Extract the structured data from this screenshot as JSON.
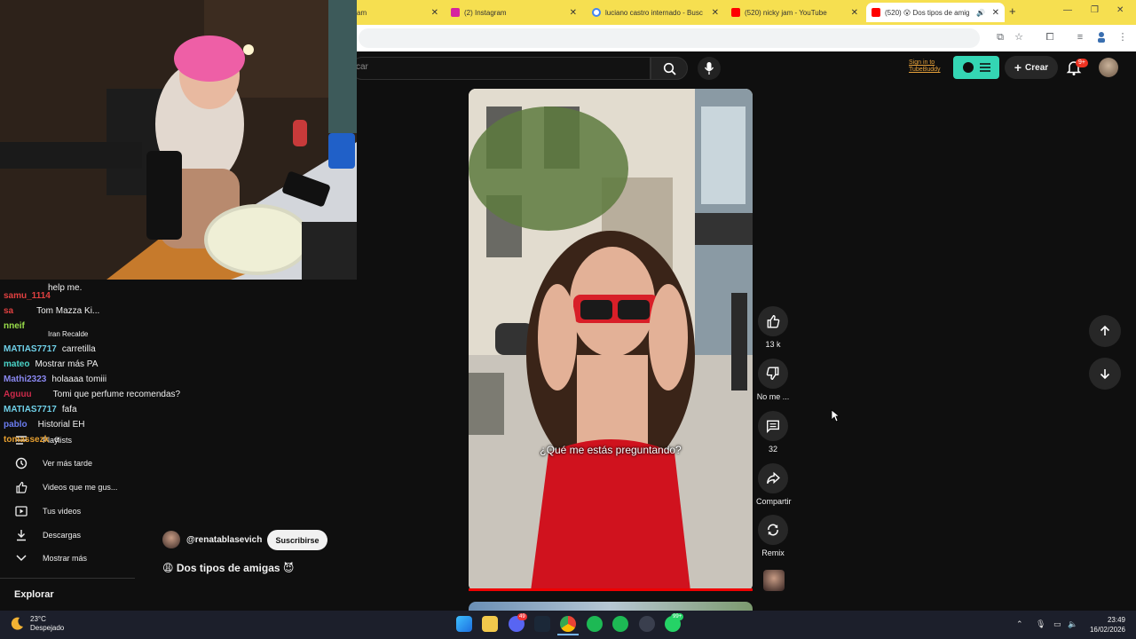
{
  "browser": {
    "tabs": [
      {
        "title": "am",
        "active": false,
        "favicon_color": "#f0c030"
      },
      {
        "title": "(2) Instagram",
        "active": false,
        "favicon_color": "#d6249f"
      },
      {
        "title": "luciano castro internado - Busc",
        "active": false,
        "favicon_color": "#4285f4"
      },
      {
        "title": "(520) nicky jam - YouTube",
        "active": false,
        "favicon_color": "#ff0000"
      },
      {
        "title": "(520) 😮 Dos tipos de amig",
        "active": true,
        "favicon_color": "#ff0000"
      }
    ],
    "new_tab_label": "+"
  },
  "youtube": {
    "search_placeholder": "car",
    "tubebuddy_line1": "Sign in to",
    "tubebuddy_line2": "TubeBuddy",
    "create_label": "Crear",
    "notifications_badge": "9+"
  },
  "chat": [
    {
      "user": "",
      "message": "help me.",
      "color": "#e04040"
    },
    {
      "user": "samu_1114",
      "message": "",
      "color": "#e04040"
    },
    {
      "user": "sa",
      "message": "Tom Mazza Ki...",
      "color": "#e04040"
    },
    {
      "user": "nneif",
      "message": "",
      "color": "#9ade4a"
    },
    {
      "user": "",
      "message": "Iran Recalde",
      "color": "#ddd"
    },
    {
      "user": "MATIAS7717",
      "message": "carretilla",
      "color": "#6fd0e8"
    },
    {
      "user": "mateo",
      "message": "Mostrar más PA",
      "color": "#4ad4c8"
    },
    {
      "user": "Mathi2323",
      "message": "holaaaa tomiii",
      "color": "#8a88f0"
    },
    {
      "user": "Aguuu",
      "message": "Tomi que perfume recomendas?",
      "color": "#cc2a4a"
    },
    {
      "user": "MATIAS7717",
      "message": "fafa",
      "color": "#6fd0e8"
    },
    {
      "user": "pablo",
      "message": "Historial EH",
      "color": "#6a7cf0"
    },
    {
      "user": "tomassezk",
      "message": "e",
      "color": "#e8a030"
    }
  ],
  "sidebar": {
    "items": [
      {
        "label": "Playlists",
        "icon": "playlist-icon"
      },
      {
        "label": "Ver más tarde",
        "icon": "clock-icon"
      },
      {
        "label": "Videos que me gus...",
        "icon": "thumbs-up-icon"
      },
      {
        "label": "Tus videos",
        "icon": "video-icon"
      },
      {
        "label": "Descargas",
        "icon": "download-icon"
      },
      {
        "label": "Mostrar más",
        "icon": "chevron-down-icon"
      }
    ],
    "explore_heading": "Explorar"
  },
  "short": {
    "channel": "@renatablasevich",
    "subscribe_label": "Suscribirse",
    "title": "😩 Dos tipos de amigas 😈",
    "caption": "¿Qué me estás preguntando?",
    "likes": "13 k",
    "dislike_label": "No me ...",
    "comments": "32",
    "share_label": "Compartir",
    "remix_label": "Remix"
  },
  "taskbar": {
    "temperature": "23°C",
    "weather": "Despejado",
    "time": "23:49",
    "date": "16/02/2026",
    "discord_badge": "49",
    "whatsapp_badge": "99+"
  }
}
